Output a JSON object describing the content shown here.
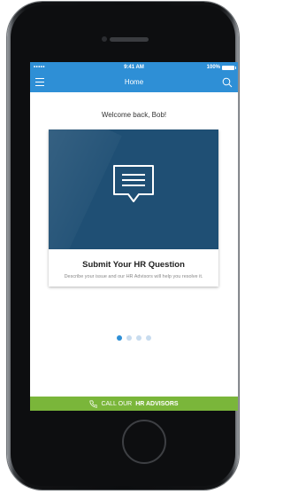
{
  "statusbar": {
    "signal": "•••••",
    "time": "9:41 AM",
    "battery": "100%"
  },
  "navbar": {
    "title": "Home"
  },
  "welcome": "Welcome back, Bob!",
  "card": {
    "title": "Submit Your HR Question",
    "description": "Describe your issue and our HR Advisors will help you resolve it.",
    "icon": "chat-bubble-icon"
  },
  "pager": {
    "count": 4,
    "active": 1
  },
  "cta": {
    "prefix": "CALL OUR",
    "strong": "HR ADVISORS",
    "icon": "phone-icon"
  },
  "colors": {
    "brand_blue": "#2e8fd6",
    "card_hero": "#1f4f74",
    "cta_green": "#7ab63a"
  }
}
